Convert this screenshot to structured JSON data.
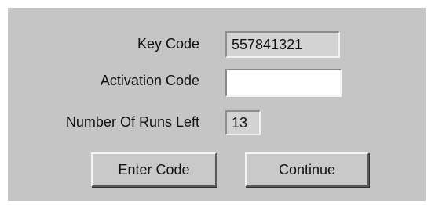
{
  "form": {
    "key_code_label": "Key Code",
    "key_code_value": "557841321",
    "activation_code_label": "Activation Code",
    "activation_code_value": "",
    "runs_left_label": "Number Of Runs Left",
    "runs_left_value": "13"
  },
  "buttons": {
    "enter_code_label": "Enter Code",
    "continue_label": "Continue"
  }
}
